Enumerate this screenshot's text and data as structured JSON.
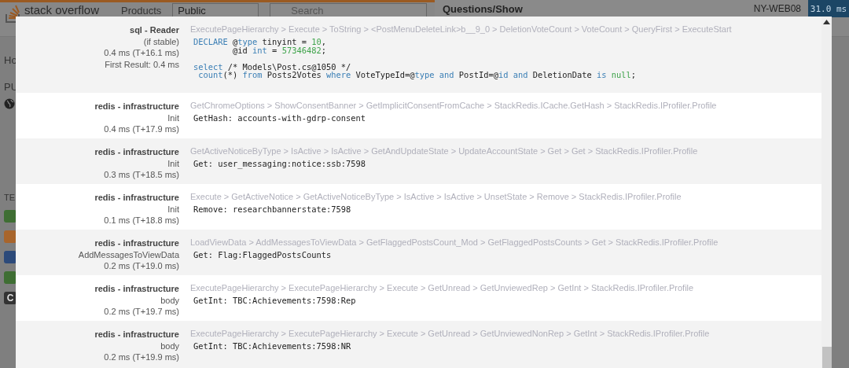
{
  "site_header": {
    "logo": "stack overflow",
    "nav": "Products",
    "scope_select": "Public",
    "search": {
      "placeholder": "Search"
    }
  },
  "sidebar": {
    "items": [
      "Ho",
      "PU"
    ],
    "section": "TE",
    "teams": [
      {
        "color": "#3f6e33"
      },
      {
        "color": "#a8652c"
      },
      {
        "color": "#2c4a7a"
      },
      {
        "color": "#3f6e33"
      },
      {
        "color": "#333333",
        "label": "C"
      }
    ]
  },
  "profiler_bar": {
    "title": "Questions/Show",
    "server": "NY-WEB08",
    "duration": "31.0 ms"
  },
  "timings": [
    {
      "type": "sql - Reader",
      "info": [
        "(if stable)",
        "0.4 ms (T+16.1 ms)",
        "First Result: 0.4 ms"
      ],
      "stack": "ExecutePageHierarchy > Execute > ToString > <PostMenuDeleteLink>b__9_0 > DeletionVoteCount > VoteCount > QueryFirst > ExecuteStart",
      "code": [
        [
          [
            {
              "text": "DECLARE",
              "kind": "kw"
            },
            {
              "text": " @",
              "kind": "plain"
            },
            {
              "text": "type",
              "kind": "kw"
            },
            {
              "text": " tinyint = ",
              "kind": "plain"
            },
            {
              "text": "10",
              "kind": "num"
            },
            {
              "text": ",",
              "kind": "plain"
            }
          ],
          [
            {
              "text": "        @id ",
              "kind": "plain"
            },
            {
              "text": "int",
              "kind": "kw"
            },
            {
              "text": " = ",
              "kind": "plain"
            },
            {
              "text": "57346482",
              "kind": "num"
            },
            {
              "text": ";",
              "kind": "plain"
            }
          ]
        ],
        [
          [
            {
              "text": "select",
              "kind": "kw"
            },
            {
              "text": " /* Models\\Post.cs@1050 */",
              "kind": "plain"
            }
          ],
          [
            {
              "text": " count",
              "kind": "kw"
            },
            {
              "text": "(*) ",
              "kind": "plain"
            },
            {
              "text": "from",
              "kind": "kw"
            },
            {
              "text": " Posts2Votes ",
              "kind": "plain"
            },
            {
              "text": "where",
              "kind": "kw"
            },
            {
              "text": " VoteTypeId=@",
              "kind": "plain"
            },
            {
              "text": "type",
              "kind": "kw"
            },
            {
              "text": " and",
              "kind": "kw"
            },
            {
              "text": " PostId=@",
              "kind": "plain"
            },
            {
              "text": "id",
              "kind": "kw"
            },
            {
              "text": " and",
              "kind": "kw"
            },
            {
              "text": " DeletionDate ",
              "kind": "plain"
            },
            {
              "text": "is",
              "kind": "kw"
            },
            {
              "text": " null",
              "kind": "num"
            },
            {
              "text": ";",
              "kind": "plain"
            }
          ]
        ]
      ]
    },
    {
      "type": "redis - infrastructure",
      "info": [
        "Init",
        "0.4 ms (T+17.9 ms)"
      ],
      "stack": "GetChromeOptions > ShowConsentBanner > GetImplicitConsentFromCache > StackRedis.ICache.GetHash > StackRedis.IProfiler.Profile",
      "code": [
        [
          [
            {
              "text": "GetHash: accounts-with-gdrp-consent",
              "kind": "plain"
            }
          ]
        ]
      ]
    },
    {
      "type": "redis - infrastructure",
      "info": [
        "Init",
        "0.3 ms (T+18.5 ms)"
      ],
      "stack": "GetActiveNoticeByType > IsActive > IsActive > GetAndUpdateState > UpdateAccountState > Get > Get > StackRedis.IProfiler.Profile",
      "code": [
        [
          [
            {
              "text": "Get: user_messaging:notice:ssb:7598",
              "kind": "plain"
            }
          ]
        ]
      ]
    },
    {
      "type": "redis - infrastructure",
      "info": [
        "Init",
        "0.1 ms (T+18.8 ms)"
      ],
      "stack": "Execute > GetActiveNotice > GetActiveNoticeByType > IsActive > IsActive > UnsetState > Remove > StackRedis.IProfiler.Profile",
      "code": [
        [
          [
            {
              "text": "Remove: researchbannerstate:7598",
              "kind": "plain"
            }
          ]
        ]
      ]
    },
    {
      "type": "redis - infrastructure",
      "info": [
        "AddMessagesToViewData",
        "0.2 ms (T+19.0 ms)"
      ],
      "stack": "LoadViewData > AddMessagesToViewData > GetFlaggedPostsCount_Mod > GetFlaggedPostsCounts > Get > StackRedis.IProfiler.Profile",
      "code": [
        [
          [
            {
              "text": "Get: Flag:FlaggedPostsCounts",
              "kind": "plain"
            }
          ]
        ]
      ]
    },
    {
      "type": "redis - infrastructure",
      "info": [
        "body",
        "0.2 ms (T+19.7 ms)"
      ],
      "stack": "ExecutePageHierarchy > ExecutePageHierarchy > Execute > GetUnread > GetUnviewedRep > GetInt > StackRedis.IProfiler.Profile",
      "code": [
        [
          [
            {
              "text": "GetInt: TBC:Achievements:7598:Rep",
              "kind": "plain"
            }
          ]
        ]
      ]
    },
    {
      "type": "redis - infrastructure",
      "info": [
        "body",
        "0.2 ms (T+19.9 ms)"
      ],
      "stack": "ExecutePageHierarchy > ExecutePageHierarchy > Execute > GetUnread > GetUnviewedNonRep > GetInt > StackRedis.IProfiler.Profile",
      "code": [
        [
          [
            {
              "text": "GetInt: TBC:Achievements:7598:NR",
              "kind": "plain"
            }
          ]
        ]
      ]
    }
  ]
}
